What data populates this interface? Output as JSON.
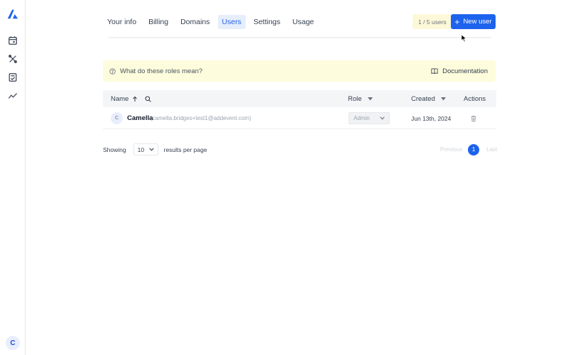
{
  "sidebar": {
    "items": [
      {
        "icon": "calendar-icon"
      },
      {
        "icon": "tools-icon"
      },
      {
        "icon": "checklist-icon"
      },
      {
        "icon": "analytics-icon"
      }
    ],
    "avatar_letter": "C"
  },
  "tabs": [
    {
      "label": "Your info"
    },
    {
      "label": "Billing"
    },
    {
      "label": "Domains"
    },
    {
      "label": "Users",
      "active": true
    },
    {
      "label": "Settings"
    },
    {
      "label": "Usage"
    }
  ],
  "header": {
    "user_count": "1 / 5 users",
    "new_user_label": "New user"
  },
  "roles_banner": {
    "question": "What do these roles mean?",
    "doc_label": "Documentation"
  },
  "table": {
    "columns": {
      "name": "Name",
      "role": "Role",
      "created": "Created",
      "actions": "Actions"
    },
    "rows": [
      {
        "avatar": "C",
        "name": "Camella",
        "email": "(camella.bridges+test1@addevent.com)",
        "role": "Admin",
        "created": "Jun 13th, 2024"
      }
    ]
  },
  "pagination": {
    "showing_label": "Showing",
    "per_page_value": "10",
    "per_page_label": "results per page",
    "previous_label": "Previous",
    "current_page": "1",
    "next_label": "Last"
  },
  "colors": {
    "accent": "#1d63ed",
    "banner_bg": "#fdfcdc",
    "count_bg": "#fdf8d8"
  }
}
